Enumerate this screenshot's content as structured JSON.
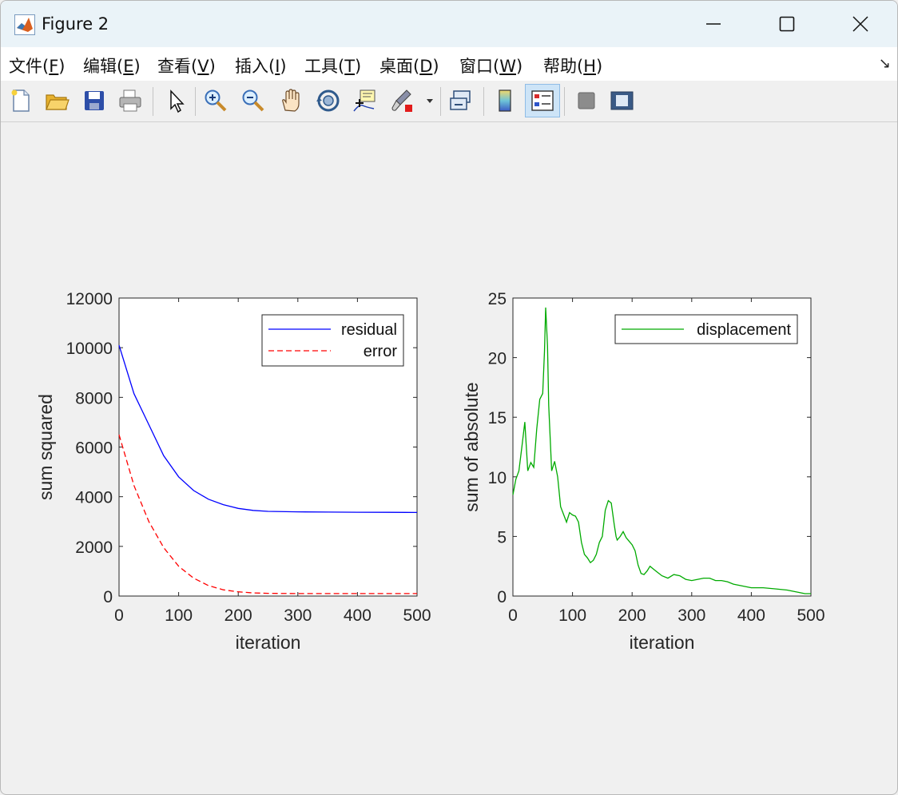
{
  "window": {
    "title": "Figure 2"
  },
  "menu": [
    {
      "pre": "文件(",
      "key": "F",
      "post": ")"
    },
    {
      "pre": "编辑(",
      "key": "E",
      "post": ")"
    },
    {
      "pre": "查看(",
      "key": "V",
      "post": ")"
    },
    {
      "pre": "插入(",
      "key": "I",
      "post": ")"
    },
    {
      "pre": "工具(",
      "key": "T",
      "post": ")"
    },
    {
      "pre": "桌面(",
      "key": "D",
      "post": ")"
    },
    {
      "pre": "窗口(",
      "key": "W",
      "post": ")"
    },
    {
      "pre": "帮助(",
      "key": "H",
      "post": ")"
    }
  ],
  "toolbar": {
    "icons": [
      "new-figure-icon",
      "open-file-icon",
      "save-icon",
      "print-icon",
      "edit-plot-arrow-icon",
      "zoom-in-icon",
      "zoom-out-icon",
      "pan-hand-icon",
      "rotate-3d-icon",
      "data-cursor-icon",
      "brush-icon",
      "brush-dropdown-icon",
      "link-plot-icon",
      "colorbar-icon",
      "legend-icon",
      "hide-plot-tools-icon",
      "show-plot-tools-icon"
    ]
  },
  "chart_data": [
    {
      "type": "line",
      "xlabel": "iteration",
      "ylabel": "sum squared",
      "xlim": [
        0,
        500
      ],
      "ylim": [
        0,
        12000
      ],
      "xticks": [
        0,
        100,
        200,
        300,
        400,
        500
      ],
      "yticks": [
        0,
        2000,
        4000,
        6000,
        8000,
        10000,
        12000
      ],
      "legend_position": "top-right",
      "series": [
        {
          "name": "residual",
          "color": "#0000ff",
          "style": "solid",
          "x": [
            0,
            25,
            50,
            75,
            100,
            125,
            150,
            175,
            200,
            225,
            250,
            300,
            350,
            400,
            450,
            500
          ],
          "y": [
            10100,
            8150,
            6900,
            5650,
            4800,
            4250,
            3900,
            3680,
            3530,
            3450,
            3410,
            3390,
            3380,
            3375,
            3370,
            3365
          ]
        },
        {
          "name": "error",
          "color": "#ff0000",
          "style": "dashed",
          "x": [
            0,
            25,
            50,
            75,
            100,
            125,
            150,
            175,
            200,
            225,
            250,
            300,
            350,
            400,
            450,
            500
          ],
          "y": [
            6500,
            4450,
            3000,
            1950,
            1200,
            720,
            420,
            250,
            170,
            125,
            110,
            100,
            100,
            100,
            100,
            100
          ]
        }
      ]
    },
    {
      "type": "line",
      "xlabel": "iteration",
      "ylabel": "sum of absolute",
      "xlim": [
        0,
        500
      ],
      "ylim": [
        0,
        25
      ],
      "xticks": [
        0,
        100,
        200,
        300,
        400,
        500
      ],
      "yticks": [
        0,
        5,
        10,
        15,
        20,
        25
      ],
      "legend_position": "top-right",
      "series": [
        {
          "name": "displacement",
          "color": "#00aa00",
          "style": "solid",
          "x": [
            0,
            5,
            10,
            15,
            20,
            25,
            30,
            35,
            40,
            45,
            50,
            53,
            55,
            58,
            60,
            65,
            70,
            75,
            80,
            90,
            95,
            100,
            105,
            110,
            115,
            120,
            125,
            130,
            135,
            140,
            145,
            150,
            155,
            160,
            165,
            170,
            173,
            175,
            180,
            185,
            190,
            195,
            200,
            205,
            210,
            215,
            220,
            225,
            230,
            240,
            250,
            260,
            270,
            280,
            290,
            300,
            310,
            320,
            330,
            340,
            350,
            360,
            370,
            380,
            390,
            400,
            420,
            440,
            460,
            480,
            490,
            500
          ],
          "y": [
            8.5,
            9.8,
            10.5,
            12.5,
            14.6,
            10.5,
            11.2,
            10.8,
            14.0,
            16.5,
            17.0,
            20.5,
            24.2,
            21.0,
            16.0,
            10.5,
            11.3,
            10.0,
            7.5,
            6.2,
            7.0,
            6.8,
            6.7,
            6.2,
            4.5,
            3.5,
            3.2,
            2.8,
            3.0,
            3.5,
            4.5,
            5.0,
            7.2,
            8.0,
            7.8,
            6.0,
            5.0,
            4.7,
            5.0,
            5.4,
            4.9,
            4.6,
            4.3,
            3.8,
            2.6,
            1.9,
            1.8,
            2.1,
            2.5,
            2.1,
            1.7,
            1.5,
            1.8,
            1.7,
            1.4,
            1.3,
            1.4,
            1.5,
            1.5,
            1.3,
            1.3,
            1.2,
            1.0,
            0.9,
            0.8,
            0.7,
            0.7,
            0.6,
            0.5,
            0.3,
            0.2,
            0.2
          ]
        }
      ]
    }
  ]
}
